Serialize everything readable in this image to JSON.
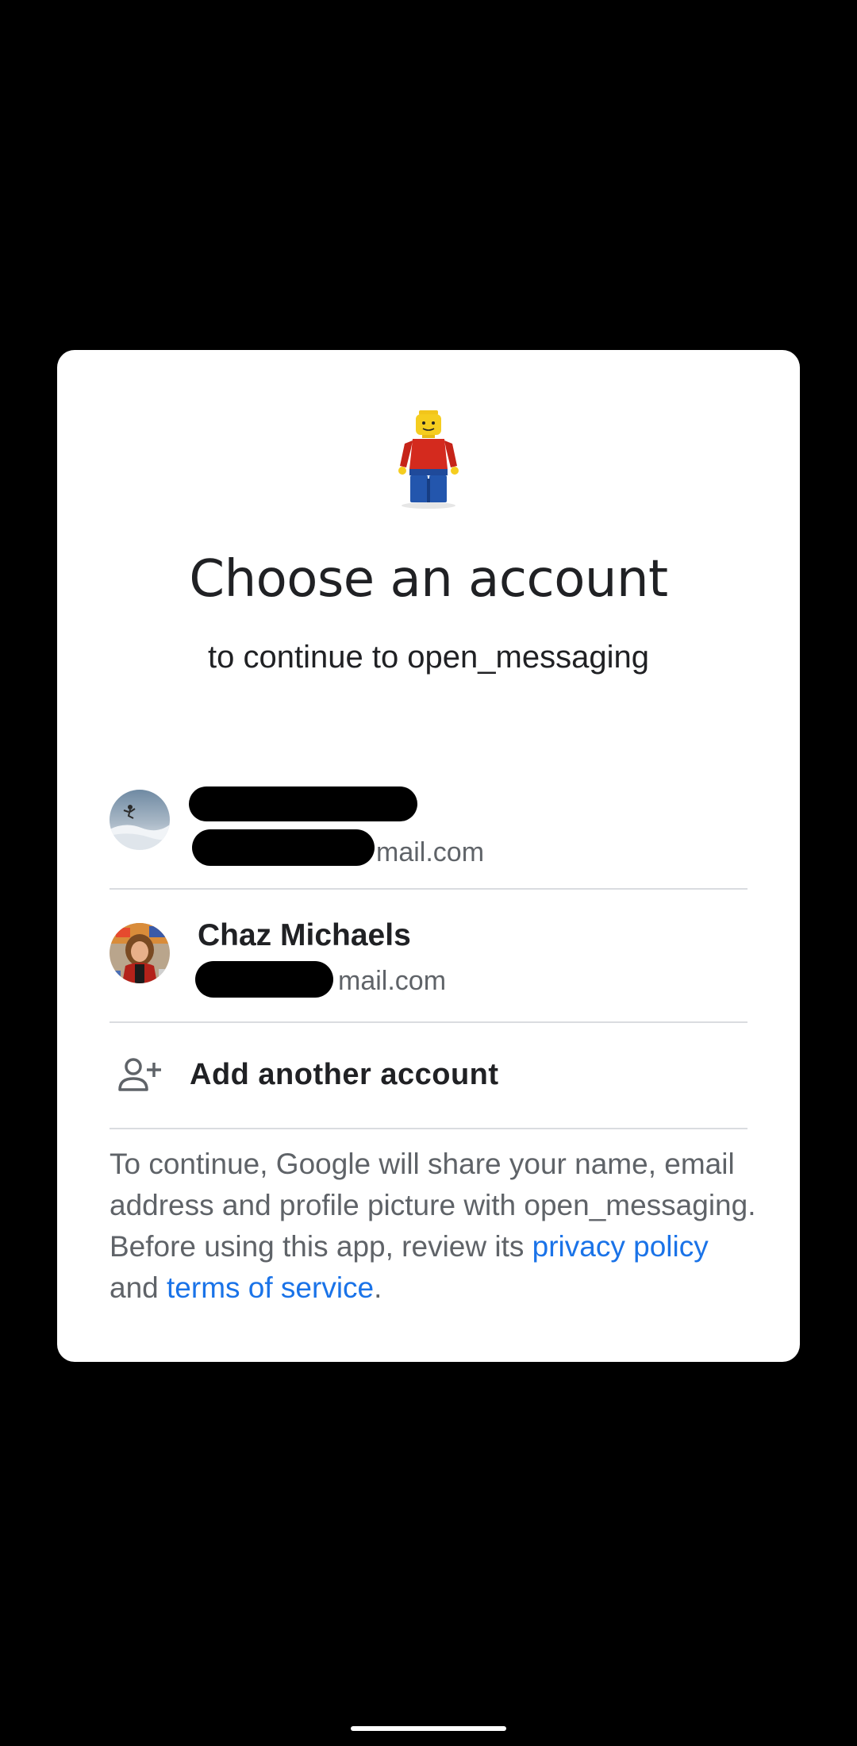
{
  "dialog": {
    "title": "Choose an account",
    "subtitle": "to continue to open_messaging"
  },
  "accounts": [
    {
      "name": "",
      "email_visible_suffix": "mail.com"
    },
    {
      "name": "Chaz Michaels",
      "email_visible_suffix": "mail.com"
    }
  ],
  "add_account": {
    "label": "Add another account",
    "icon": "add-person-icon"
  },
  "disclaimer": {
    "text_before": "To continue, Google will share your name, email address and profile picture with open_messaging. Before using this app, review its ",
    "privacy_link": "privacy policy",
    "text_middle": " and ",
    "terms_link": "terms of service",
    "text_after": "."
  },
  "colors": {
    "link": "#1a73e8",
    "text_primary": "#202124",
    "text_secondary": "#5f6368",
    "divider": "#dadce0"
  }
}
